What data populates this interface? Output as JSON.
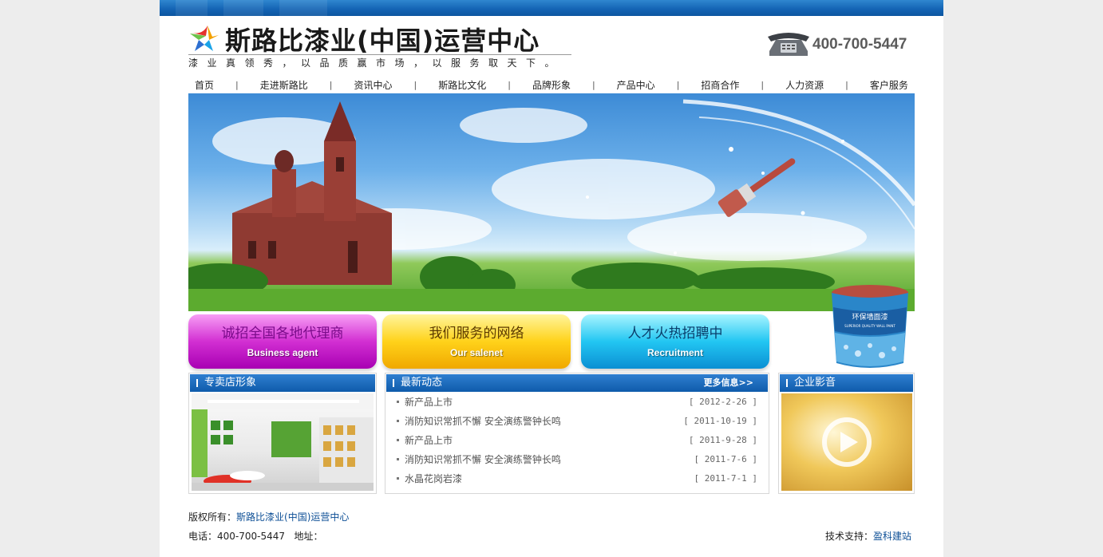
{
  "header": {
    "title": "斯路比漆业(中国)运营中心",
    "slogan": "漆业真领秀，以品质赢市场，以服务取天下。",
    "phone": "400-700-5447"
  },
  "nav": {
    "items": [
      "首页",
      "走进斯路比",
      "资讯中心",
      "斯路比文化",
      "品牌形象",
      "产品中心",
      "招商合作",
      "人力资源",
      "客户服务"
    ]
  },
  "promos": [
    {
      "cn": "诚招全国各地代理商",
      "en": "Business agent"
    },
    {
      "cn": "我们服务的网络",
      "en": "Our salenet"
    },
    {
      "cn": "人才火热招聘中",
      "en": "Recruitment"
    }
  ],
  "bucket": {
    "label_cn": "环保墙面漆",
    "label_en": "SUPERIOR QUALITY WALL PAINT"
  },
  "panels": {
    "store": {
      "title": "专卖店形象"
    },
    "news": {
      "title": "最新动态",
      "more": "更多信息>>",
      "items": [
        {
          "title": "新产品上市",
          "date": "[ 2012-2-26 ]"
        },
        {
          "title": "消防知识常抓不懈 安全演练警钟长鸣",
          "date": "[ 2011-10-19 ]"
        },
        {
          "title": "新产品上市",
          "date": "[ 2011-9-28 ]"
        },
        {
          "title": "消防知识常抓不懈 安全演练警钟长鸣",
          "date": "[ 2011-7-6 ]"
        },
        {
          "title": "水晶花岗岩漆",
          "date": "[ 2011-7-1 ]"
        }
      ]
    },
    "video": {
      "title": "企业影音"
    }
  },
  "footer": {
    "copyright_label": "版权所有：",
    "copyright_link": "斯路比漆业(中国)运营中心",
    "contact": "电话：400-700-5447   地址：",
    "support_label": "技术支持：",
    "support_link": "盈科建站"
  },
  "colors": {
    "topbar": "#1565b5",
    "panel_head": "#0f5bab",
    "link": "#0d4f96",
    "promo_purple": "#c41fc8",
    "promo_yellow": "#ffd21a",
    "promo_cyan": "#22c6f2"
  }
}
